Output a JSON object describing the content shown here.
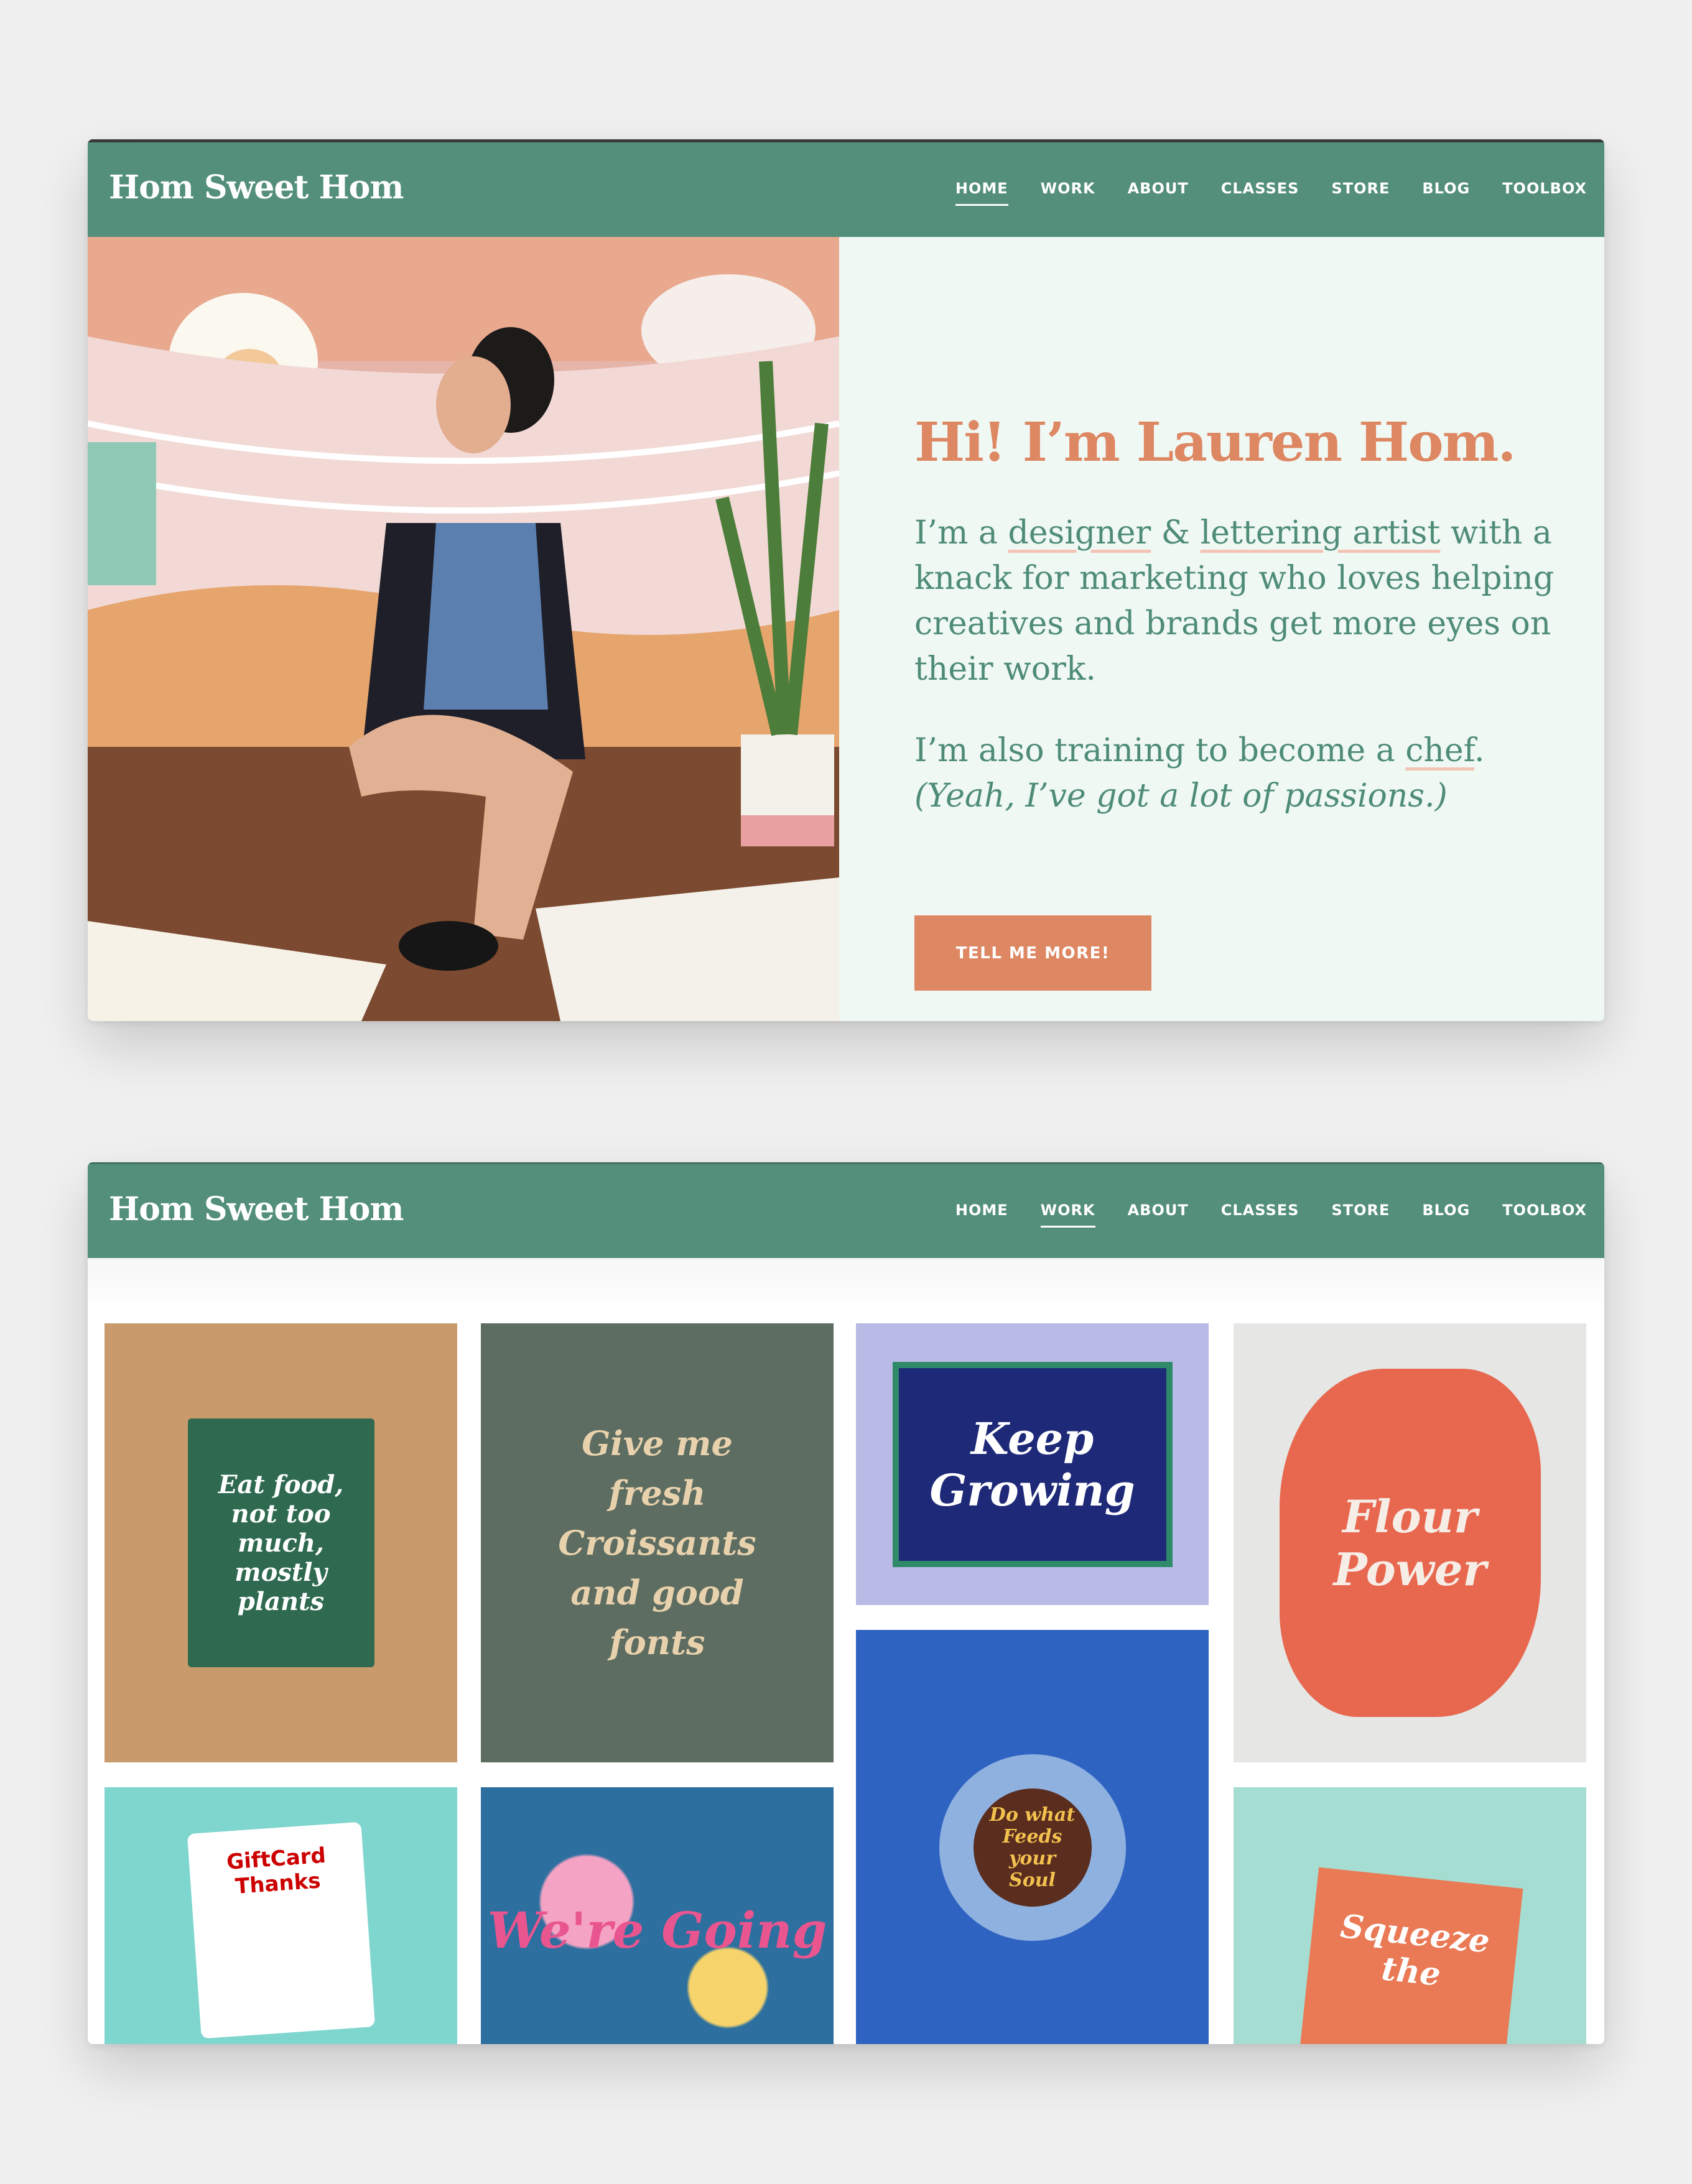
{
  "site": {
    "logo": "Hom Sweet Hom",
    "nav": [
      "HOME",
      "WORK",
      "ABOUT",
      "CLASSES",
      "STORE",
      "BLOG",
      "TOOLBOX"
    ]
  },
  "home": {
    "active_nav": "HOME",
    "heading": "Hi! I’m Lauren Hom.",
    "intro": {
      "pre": "I’m a ",
      "link1": "designer",
      "mid": " & ",
      "link2": "lettering artist",
      "post": " with a knack for marketing who loves helping creatives and brands get more eyes on their work."
    },
    "second": {
      "pre": "I’m also training to become a ",
      "link": "chef",
      "post": ".",
      "aside": "(Yeah, I’ve got a lot of passions.)"
    },
    "cta": "TELL ME MORE!"
  },
  "work": {
    "active_nav": "WORK",
    "tiles": [
      {
        "name": "eat-food-poster",
        "lettering": "Eat food, not too much, mostly plants",
        "bg": "#c89a6c"
      },
      {
        "name": "croissants-and-good-fonts",
        "lettering": "Give me fresh Croissants and good fonts",
        "bg": "#5e6d61"
      },
      {
        "name": "keep-growing",
        "lettering": "Keep Growing",
        "bg": "#b9bbe6"
      },
      {
        "name": "flour-power",
        "lettering": "Flour Power",
        "bg": "#e6e6e4"
      },
      {
        "name": "do-what-feeds-your-soul",
        "lettering": "Do what Feeds your Soul",
        "bg": "#2e63c2"
      },
      {
        "name": "target-giftcards",
        "lettering": "GiftCard Thanks",
        "bg": "#7fd6cf"
      },
      {
        "name": "were-going-places",
        "lettering": "We're Going",
        "bg": "#2d6f9e"
      },
      {
        "name": "squeeze-the-day",
        "lettering": "Squeeze the",
        "bg": "#a6ddd2"
      }
    ]
  }
}
